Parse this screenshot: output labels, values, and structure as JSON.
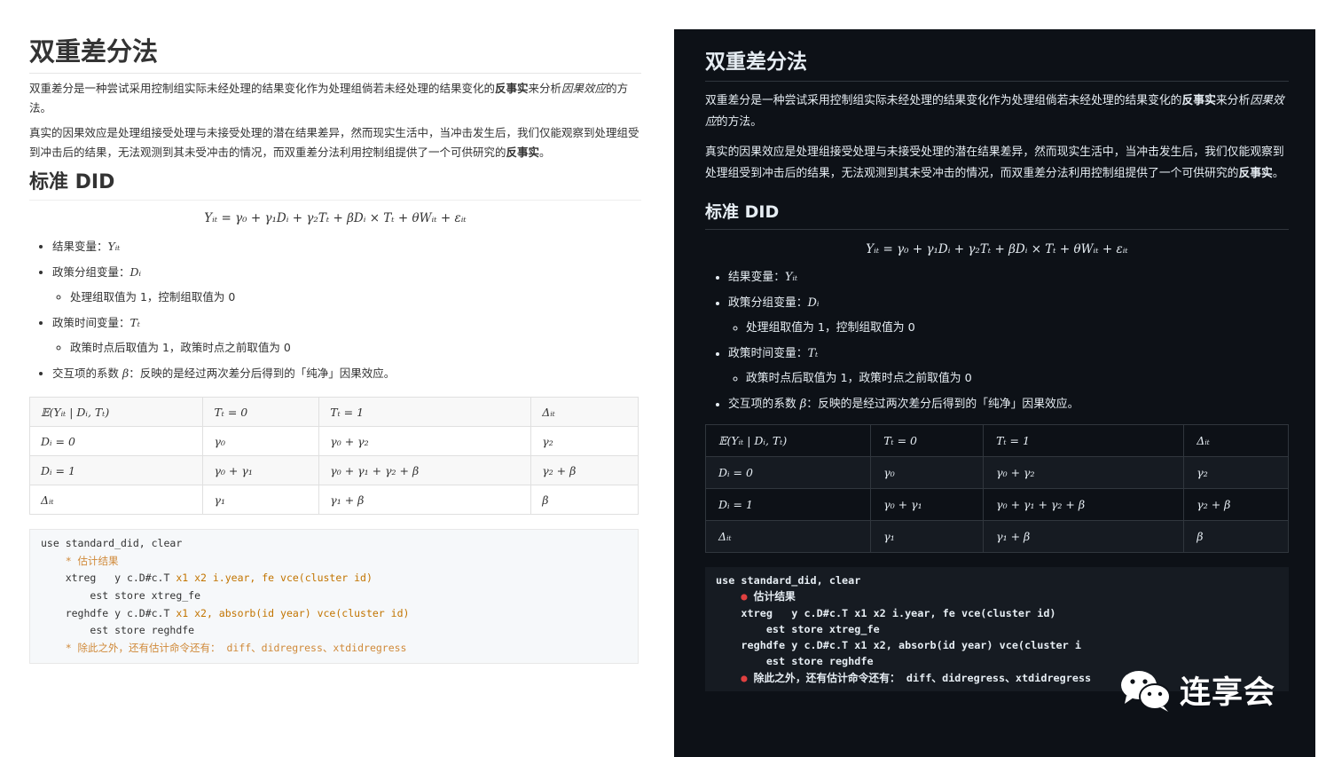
{
  "left": {
    "title": "双重差分法",
    "p1_a": "双重差分是一种尝试采用控制组实际未经处理的结果变化作为处理组倘若未经处理的结果变化的",
    "p1_bold": "反事实",
    "p1_b": "来分析",
    "p1_italic": "因果效应",
    "p1_c": "的方法。",
    "p2_a": "真实的因果效应是处理组接受处理与未接受处理的潜在结果差异，然而现实生活中，当冲击发生后，我们仅能观察到处理组受到冲击后的结果，无法观测到其未受冲击的情况，而双重差分法利用控制组提供了一个可供研究的",
    "p2_bold": "反事实",
    "p2_c": "。",
    "h2": "标准 DID"
  },
  "right": {
    "title": "双重差分法",
    "p1_a": "双重差分是一种尝试采用控制组实际未经处理的结果变化作为处理组倘若未经处理的结果变化的",
    "p1_bold": "反事实",
    "p1_b": "来分析",
    "p1_italic": "因果效应",
    "p1_c": "的方法。",
    "p2_a": "真实的因果效应是处理组接受处理与未接受处理的潜在结果差异，然而现实生活中，当冲击发生后，我们仅能观察到处理组受到冲击后的结果，无法观测到其未受冲击的情况，而双重差分法利用控制组提供了一个可供研究的",
    "p2_bold": "反事实",
    "p2_c": "。",
    "h2": "标准 DID"
  },
  "formula": "Yᵢₜ = γ₀ + γ₁Dᵢ + γ₂Tₜ + βDᵢ × Tₜ + θWᵢₜ + εᵢₜ",
  "bullets": {
    "b1": "结果变量：",
    "b1_m": "Yᵢₜ",
    "b2": "政策分组变量：",
    "b2_m": "Dᵢ",
    "b2_sub": "处理组取值为 1，控制组取值为 0",
    "b3": "政策时间变量：",
    "b3_m": "Tₜ",
    "b3_sub": "政策时点后取值为 1，政策时点之前取值为 0",
    "b4_a": "交互项的系数 ",
    "b4_m": "β",
    "b4_b": "：反映的是经过两次差分后得到的「纯净」因果效应。"
  },
  "table": {
    "rows": [
      [
        "𝔼(Yᵢₜ | Dᵢ, Tₜ)",
        "Tₜ = 0",
        "Tₜ = 1",
        "Δᵢₜ"
      ],
      [
        "Dᵢ = 0",
        "γ₀",
        "γ₀ + γ₂",
        "γ₂"
      ],
      [
        "Dᵢ = 1",
        "γ₀ + γ₁",
        "γ₀ + γ₁ + γ₂ + β",
        "γ₂ + β"
      ],
      [
        "Δᵢₜ",
        "γ₁",
        "γ₁ + β",
        "β"
      ]
    ]
  },
  "code": {
    "l1": "use standard_did, clear",
    "l2": "* 估计结果",
    "l3_a": "xtreg   y c.D#c.T ",
    "l3_b": "x1 x2 i.year, fe vce(cluster id)",
    "l4": "    est store xtreg_fe",
    "l5_a": "reghdfe y c.D#c.T ",
    "l5_b": "x1 x2, absorb(id year) vce(cluster id)",
    "l6": "    est store reghdfe",
    "l7": "* 除此之外，还有估计命令还有： diff、didregress、xtdidregress"
  },
  "code_dark": {
    "l1": "use standard_did, clear",
    "l2": "估计结果",
    "l3": "xtreg   y c.D#c.T x1 x2 i.year, fe vce(cluster id)",
    "l4": "    est store xtreg_fe",
    "l5": "reghdfe y c.D#c.T x1 x2, absorb(id year) vce(cluster i",
    "l6": "    est store reghdfe",
    "l7": "除此之外，还有估计命令还有： diff、didregress、xtdidregress"
  },
  "watermark": {
    "icon": "wechat-icon",
    "text": "连享会"
  }
}
